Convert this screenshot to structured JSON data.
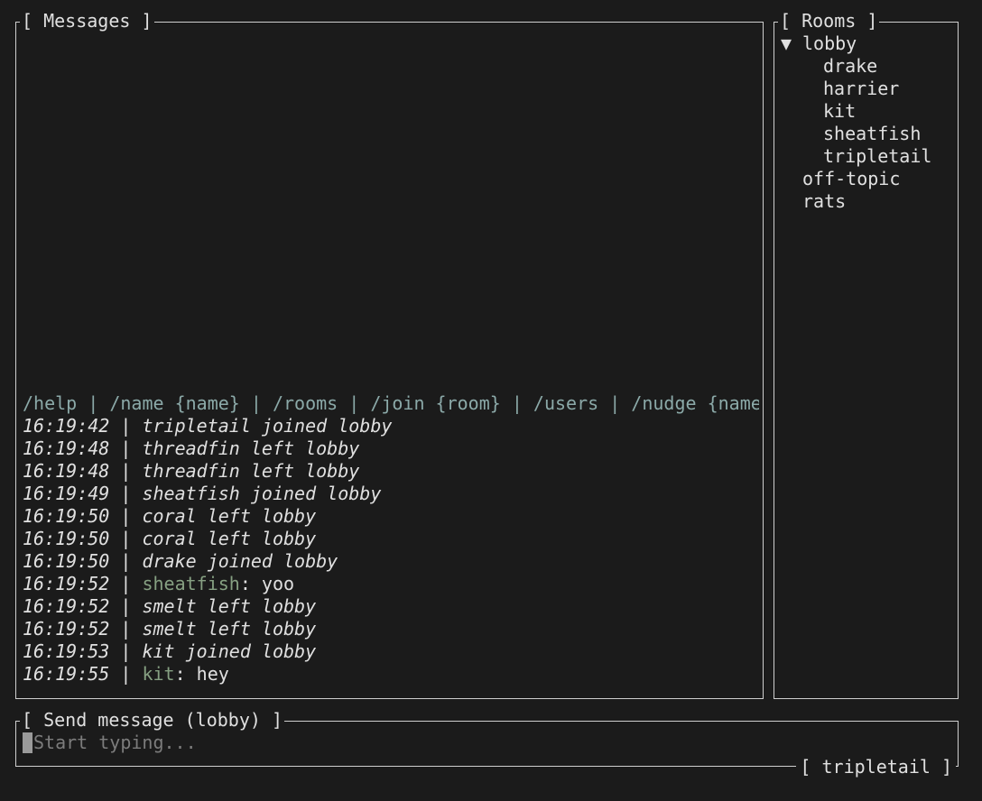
{
  "messages_panel": {
    "title": "[ Messages ]",
    "help_line": "/help | /name {name} | /rooms | /join {room} | /users | /nudge {name",
    "entries": [
      {
        "time": "16:19:42",
        "sep": " | ",
        "text": "tripletail joined lobby"
      },
      {
        "time": "16:19:48",
        "sep": " | ",
        "text": "threadfin left lobby"
      },
      {
        "time": "16:19:48",
        "sep": " | ",
        "text": "threadfin left lobby"
      },
      {
        "time": "16:19:49",
        "sep": " | ",
        "text": "sheatfish joined lobby"
      },
      {
        "time": "16:19:50",
        "sep": " | ",
        "text": "coral left lobby"
      },
      {
        "time": "16:19:50",
        "sep": " | ",
        "text": "coral left lobby"
      },
      {
        "time": "16:19:50",
        "sep": " | ",
        "text": "drake joined lobby"
      },
      {
        "time": "16:19:52",
        "sep": " | ",
        "user": "sheatfish",
        "colon": ": ",
        "msg": "yoo"
      },
      {
        "time": "16:19:52",
        "sep": " | ",
        "text": "smelt left lobby"
      },
      {
        "time": "16:19:52",
        "sep": " | ",
        "text": "smelt left lobby"
      },
      {
        "time": "16:19:53",
        "sep": " | ",
        "text": "kit joined lobby"
      },
      {
        "time": "16:19:55",
        "sep": " | ",
        "user": "kit",
        "colon": ": ",
        "msg": "hey"
      }
    ]
  },
  "rooms_panel": {
    "title": "[ Rooms ]",
    "expanded_marker": "▼",
    "rooms": [
      {
        "name": "lobby",
        "users": [
          "drake",
          "harrier",
          "kit",
          "sheatfish",
          "tripletail"
        ]
      },
      {
        "name": "off-topic"
      },
      {
        "name": "rats"
      }
    ]
  },
  "send_panel": {
    "title": "[ Send message (lobby) ]",
    "placeholder": "Start typing...",
    "current_user": "[ tripletail ]"
  },
  "colors": {
    "background": "#1b1b1b",
    "text": "#e0e0e0",
    "help": "#8ba9a8",
    "username": "#86a082",
    "border": "#cfcfcf"
  }
}
